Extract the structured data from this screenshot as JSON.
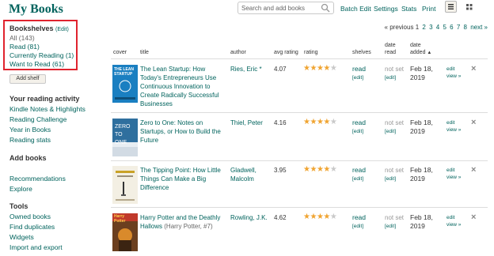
{
  "page_title": "My Books",
  "header": {
    "search_placeholder": "Search and add books",
    "links": [
      "Batch Edit",
      "Settings",
      "Stats",
      "Print"
    ]
  },
  "sidebar": {
    "bookshelves_label": "Bookshelves",
    "edit_label": "(Edit)",
    "shelves": [
      "All (143)",
      "Read (81)",
      "Currently Reading (1)",
      "Want to Read (61)"
    ],
    "add_shelf_label": "Add shelf",
    "reading_activity_title": "Your reading activity",
    "reading_activity_items": [
      "Kindle Notes & Highlights",
      "Reading Challenge",
      "Year in Books",
      "Reading stats"
    ],
    "add_books_title": "Add books",
    "add_books_items": [
      "Recommendations",
      "Explore"
    ],
    "tools_title": "Tools",
    "tools_items": [
      "Owned books",
      "Find duplicates",
      "Widgets",
      "Import and export"
    ]
  },
  "pagination": {
    "previous": "« previous",
    "pages": [
      "1",
      "2",
      "3",
      "4",
      "5",
      "6",
      "7",
      "8"
    ],
    "next": "next »"
  },
  "columns": {
    "cover": "cover",
    "title": "title",
    "author": "author",
    "avg_rating": "avg rating",
    "rating": "rating",
    "shelves": "shelves",
    "date_read": "date read",
    "date_added": "date added"
  },
  "books": [
    {
      "title": "The Lean Startup: How Today's Entrepreneurs Use Continuous Innovation to Create Radically Successful Businesses",
      "series": "",
      "author": "Ries, Eric *",
      "avg_rating": "4.07",
      "rating": 4,
      "shelf": "read",
      "shelf_edit": "[edit]",
      "date_read": "not set",
      "date_read_edit": "[edit]",
      "date_added": "Feb 18, 2019",
      "edit": "edit",
      "view": "view »",
      "cover_text": "THE LEAN STARTUP",
      "cover_color": "#1a7fc1"
    },
    {
      "title": "Zero to One: Notes on Startups, or How to Build the Future",
      "series": "",
      "author": "Thiel, Peter",
      "avg_rating": "4.16",
      "rating": 4,
      "shelf": "read",
      "shelf_edit": "[edit]",
      "date_read": "not set",
      "date_read_edit": "[edit]",
      "date_added": "Feb 18, 2019",
      "edit": "edit",
      "view": "view »",
      "cover_text": "ZERO TO ONE",
      "cover_color": "#2f6f9e"
    },
    {
      "title": "The Tipping Point: How Little Things Can Make a Big Difference",
      "series": "",
      "author": "Gladwell, Malcolm",
      "avg_rating": "3.95",
      "rating": 4,
      "shelf": "read",
      "shelf_edit": "[edit]",
      "date_read": "not set",
      "date_read_edit": "[edit]",
      "date_added": "Feb 18, 2019",
      "edit": "edit",
      "view": "view »",
      "cover_text": "",
      "cover_color": "#f3efe3"
    },
    {
      "title": "Harry Potter and the Deathly Hallows",
      "series": "(Harry Potter, #7)",
      "author": "Rowling, J.K.",
      "avg_rating": "4.62",
      "rating": 4,
      "shelf": "read",
      "shelf_edit": "[edit]",
      "date_read": "not set",
      "date_read_edit": "[edit]",
      "date_added": "Feb 18, 2019",
      "edit": "edit",
      "view": "view »",
      "cover_text": "Harry Potter",
      "cover_color": "#8b5a2b"
    }
  ],
  "colors": {
    "brand": "#00635d",
    "highlight_box": "#e0232e",
    "star": "#f0a431"
  }
}
